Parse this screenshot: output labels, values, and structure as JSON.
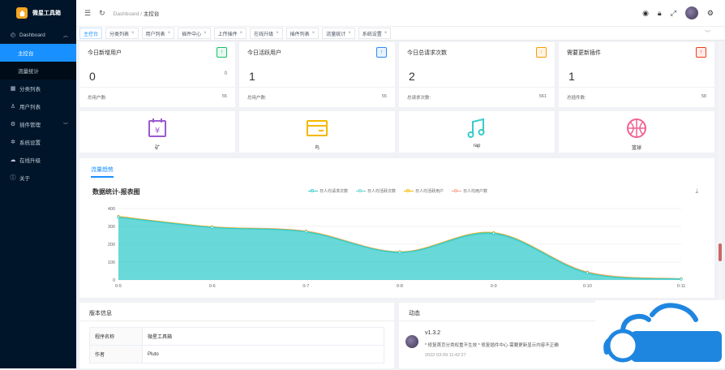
{
  "app": {
    "title": "微星工具箱"
  },
  "sidebar": {
    "items": [
      {
        "label": "Dashboard",
        "icon": "dashboard-icon"
      },
      {
        "label": "主控台"
      },
      {
        "label": "流量统计"
      },
      {
        "label": "分类列表",
        "icon": "grid-icon"
      },
      {
        "label": "用户列表",
        "icon": "user-icon"
      },
      {
        "label": "插件管理",
        "icon": "plugin-icon"
      },
      {
        "label": "系统设置",
        "icon": "gear-icon"
      },
      {
        "label": "在线升级",
        "icon": "cloud-icon"
      },
      {
        "label": "关于",
        "icon": "info-icon"
      }
    ]
  },
  "header": {
    "breadcrumb_root": "Dashboard",
    "breadcrumb_sep": "/",
    "breadcrumb_current": "主控台"
  },
  "tabs": [
    "主控台",
    "分类列表",
    "用户列表",
    "插件中心",
    "上传插件",
    "在线升级",
    "插件列表",
    "流量统计",
    "系统设置"
  ],
  "stats": [
    {
      "title": "今日新增用户",
      "value": "0",
      "small": "0",
      "foot_label": "总用户数:",
      "foot_value": "55",
      "badge": "↑",
      "badge_color": "#19be6b",
      "badge_bg": "#e8f8ef"
    },
    {
      "title": "今日活跃用户",
      "value": "1",
      "small": "",
      "foot_label": "总用户数:",
      "foot_value": "55",
      "badge": "↑",
      "badge_color": "#2d8cf0",
      "badge_bg": "#e8f3fe"
    },
    {
      "title": "今日总请求次数",
      "value": "2",
      "small": "",
      "foot_label": "总请求次数:",
      "foot_value": "561",
      "badge": "↑",
      "badge_color": "#ff9900",
      "badge_bg": "#fff5e6"
    },
    {
      "title": "需要更新插件",
      "value": "1",
      "small": "",
      "foot_label": "总插件数:",
      "foot_value": "58",
      "badge": "↑",
      "badge_color": "#ed4014",
      "badge_bg": "#fdecea"
    }
  ],
  "icon_cards": [
    {
      "label": "矿",
      "icon": "calendar-yen-icon",
      "color": "#9b59d0"
    },
    {
      "label": "鸟",
      "icon": "card-icon",
      "color": "#f5b800"
    },
    {
      "label": "rap",
      "icon": "music-icon",
      "color": "#36cbcb"
    },
    {
      "label": "篮球",
      "icon": "basketball-icon",
      "color": "#f06292"
    }
  ],
  "chart_section": {
    "tab": "流量趋势",
    "title": "数据统计-报表图"
  },
  "chart_data": {
    "type": "area",
    "title": "数据统计-报表图",
    "x": [
      "0-5",
      "0-6",
      "0-7",
      "0-8",
      "0-9",
      "0-10",
      "0-11"
    ],
    "ylim": [
      0,
      400
    ],
    "yticks": [
      "0",
      "100",
      "200",
      "300",
      "400"
    ],
    "grid": true,
    "legend_position": "top",
    "series": [
      {
        "name": "日人均请求次数",
        "color": "#36cbcb",
        "values": [
          352,
          295,
          270,
          155,
          262,
          40,
          5
        ]
      },
      {
        "name": "日人均活跃次数",
        "color": "#64d5d5",
        "values": [
          350,
          293,
          268,
          153,
          258,
          38,
          4
        ]
      },
      {
        "name": "日人均活跃用户",
        "color": "#f5b800",
        "values": [
          355,
          297,
          272,
          157,
          265,
          42,
          6
        ]
      },
      {
        "name": "日人均用户数",
        "color": "#f4a28c",
        "values": [
          356,
          298,
          274,
          158,
          266,
          45,
          7
        ]
      }
    ]
  },
  "version": {
    "title": "版本信息",
    "rows": [
      {
        "key": "程序名称",
        "value": "微星工具箱"
      },
      {
        "key": "作者",
        "value": "Pluto"
      }
    ]
  },
  "news": {
    "title": "动态",
    "version": "v1.3.2",
    "text": "* 修复首页分类权重不生效 * 修复插件中心-需要更新显示内容不正确",
    "time": "2022-03-09 11:42:27"
  }
}
